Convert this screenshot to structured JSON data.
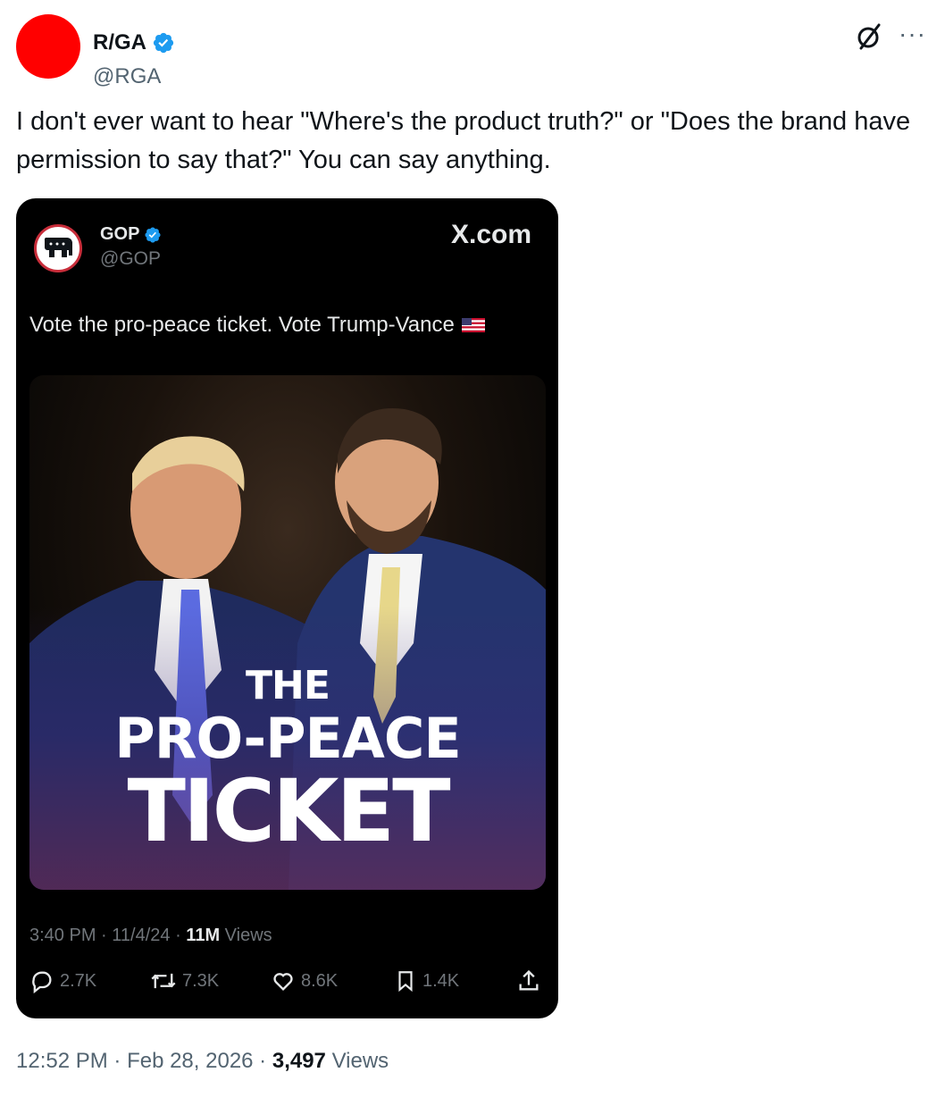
{
  "author": {
    "display_name": "R/GA",
    "handle": "@RGA",
    "avatar_color": "#ff0000",
    "verified": true
  },
  "post_text": "I don't ever want to hear \"Where's the product truth?\" or \"Does the brand have permission to say that?\" You can say anything.",
  "embedded": {
    "display_name": "GOP",
    "handle": "@GOP",
    "site_label": "X.com",
    "text": "Vote the pro-peace ticket. Vote Trump-Vance",
    "image_headline": {
      "line1": "THE",
      "line2": "PRO-PEACE",
      "line3": "TICKET"
    },
    "time": "3:40 PM",
    "date": "11/4/24",
    "views_count": "11M",
    "views_label": "Views",
    "replies": "2.7K",
    "reposts": "7.3K",
    "likes": "8.6K",
    "bookmarks": "1.4K"
  },
  "footer": {
    "time": "12:52 PM",
    "date": "Feb 28, 2026",
    "views_count": "3,497",
    "views_label": "Views"
  },
  "icons": [
    "verified-badge-icon",
    "grok-icon",
    "more-icon",
    "gop-elephant-icon",
    "us-flag-icon",
    "reply-icon",
    "repost-icon",
    "like-icon",
    "bookmark-icon",
    "share-icon"
  ],
  "colors": {
    "verified_blue": "#1d9bf0",
    "muted_text": "#536471",
    "card_bg": "#000000"
  }
}
